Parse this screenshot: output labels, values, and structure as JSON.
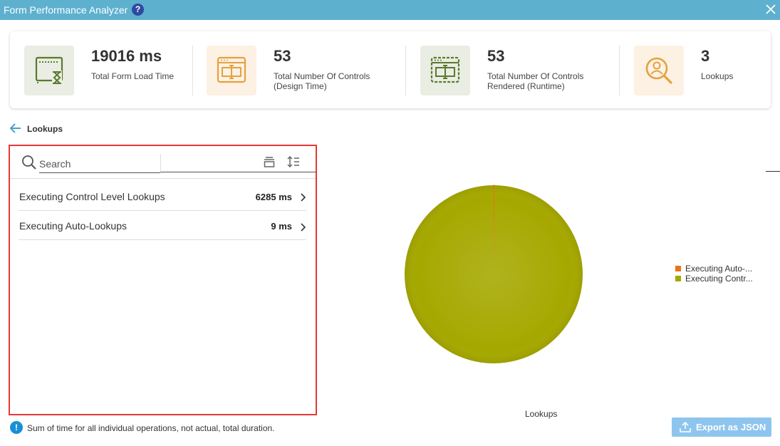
{
  "window": {
    "title": "Form Performance Analyzer",
    "help_icon": "help-circle-icon",
    "close_icon": "close-icon"
  },
  "stats": [
    {
      "value": "19016 ms",
      "label": "Total Form Load Time",
      "icon": "hourglass-window-icon",
      "icon_bg": "#eaede3",
      "icon_color": "#5a7a2e"
    },
    {
      "value": "53",
      "label": "Total Number Of Controls (Design Time)",
      "icon": "text-control-icon",
      "icon_bg": "#fdf1e3",
      "icon_color": "#e3a23f"
    },
    {
      "value": "53",
      "label": "Total Number Of Controls Rendered (Runtime)",
      "icon": "text-control-runtime-icon",
      "icon_bg": "#eaede3",
      "icon_color": "#5a7a2e"
    },
    {
      "value": "3",
      "label": "Lookups",
      "icon": "lookup-search-icon",
      "icon_bg": "#fdf1e3",
      "icon_color": "#e3a23f"
    }
  ],
  "breadcrumb": {
    "back_label": "Lookups"
  },
  "list": {
    "search_placeholder": "Search",
    "rows": [
      {
        "name": "Executing Control Level Lookups",
        "time": "6285 ms"
      },
      {
        "name": "Executing Auto-Lookups",
        "time": "9 ms"
      }
    ]
  },
  "note": {
    "text": "Sum of time for all individual operations, not actual, total duration."
  },
  "chart_data": {
    "type": "pie",
    "title": "",
    "caption": "Lookups",
    "slices": [
      {
        "name": "Executing Control Level Lookups",
        "value": 6285,
        "color": "#a6a800"
      },
      {
        "name": "Executing Auto-Lookups",
        "value": 9,
        "color": "#e8741a"
      }
    ],
    "legend": [
      {
        "label": "Executing Auto-...",
        "color": "#e8741a"
      },
      {
        "label": "Executing Contr...",
        "color": "#a6a800"
      }
    ],
    "legend_position": "right"
  },
  "actions": {
    "export_label": "Export as JSON"
  },
  "colors": {
    "titlebar": "#5eb0cf",
    "accent_border": "#e53935",
    "export_button": "#8ec5ef"
  }
}
